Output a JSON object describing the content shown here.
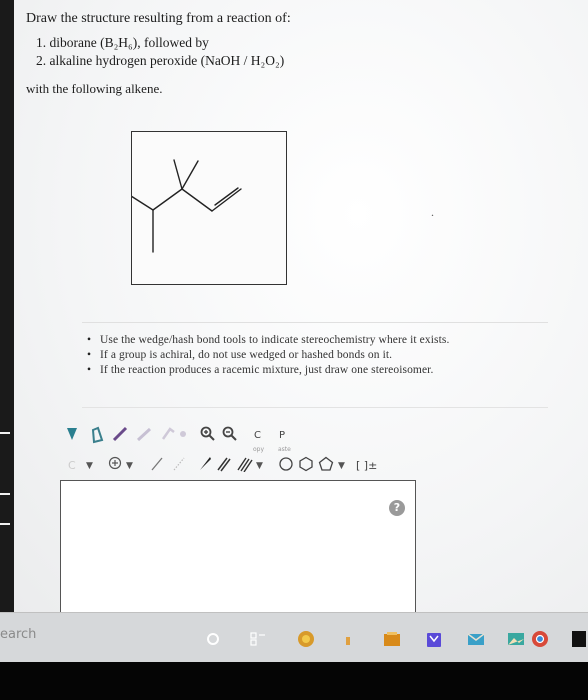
{
  "question": {
    "intro": "Draw the structure resulting from a reaction of:",
    "steps": [
      "1. diborane (B₂H₆), followed by",
      "2. alkaline hydrogen peroxide (NaOH / H₂O₂)"
    ],
    "with_text": "with the following alkene."
  },
  "notes": [
    "Use the wedge/hash bond tools to indicate stereochemistry where it exists.",
    "If a group is achiral, do not use wedged or hashed bonds on it.",
    "If the reaction produces a racemic mixture, just draw one stereoisomer."
  ],
  "toolbar": {
    "copy_letter": "C",
    "copy_sub": "opy",
    "paste_letter": "P",
    "paste_sub": "aste",
    "charge_label": "C",
    "bracket_label": "[ ]±"
  },
  "help_label": "?",
  "taskbar": {
    "search_label": "earch"
  },
  "colors": {
    "accent_teal": "#2a7f8f",
    "help_grey": "#9a9a9a",
    "ring_orange": "#d89a2a"
  }
}
